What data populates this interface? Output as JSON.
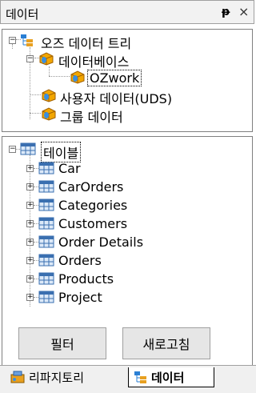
{
  "window": {
    "title": "데이터",
    "pin_glyph": "ᵽ",
    "close_glyph": "×"
  },
  "tree_top": {
    "root": "오즈 데이터 트리",
    "database": "데이터베이스",
    "ozwork": "OZwork",
    "user_data": "사용자 데이터(UDS)",
    "group_data": "그룹 데이터"
  },
  "tree_tables": {
    "root": "테이블",
    "items": [
      "Car",
      "CarOrders",
      "Categories",
      "Customers",
      "Order Details",
      "Orders",
      "Products",
      "Project"
    ]
  },
  "buttons": {
    "filter": "필터",
    "refresh": "새로고침"
  },
  "tabs": {
    "repository": "리파지토리",
    "data": "데이터"
  }
}
